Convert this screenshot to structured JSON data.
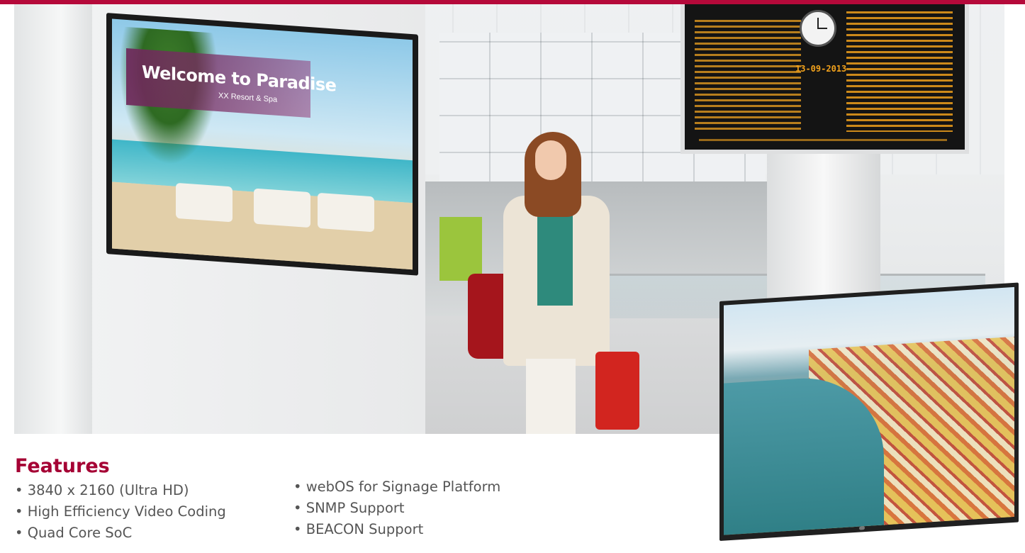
{
  "brand": {
    "accent": "#a50034",
    "topbar": "#b5093a"
  },
  "hero": {
    "wall_display": {
      "title": "Welcome to Paradise",
      "subtitle": "XX Resort & Spa"
    },
    "departure_board": {
      "date": "13-09-2013"
    }
  },
  "features": {
    "heading": "Features",
    "left": [
      "• 3840 x 2160 (Ultra HD)",
      "• High Efficiency Video Coding",
      "• Quad Core SoC"
    ],
    "right": [
      "• webOS for Signage Platform",
      "• SNMP Support",
      "• BEACON Support"
    ]
  }
}
